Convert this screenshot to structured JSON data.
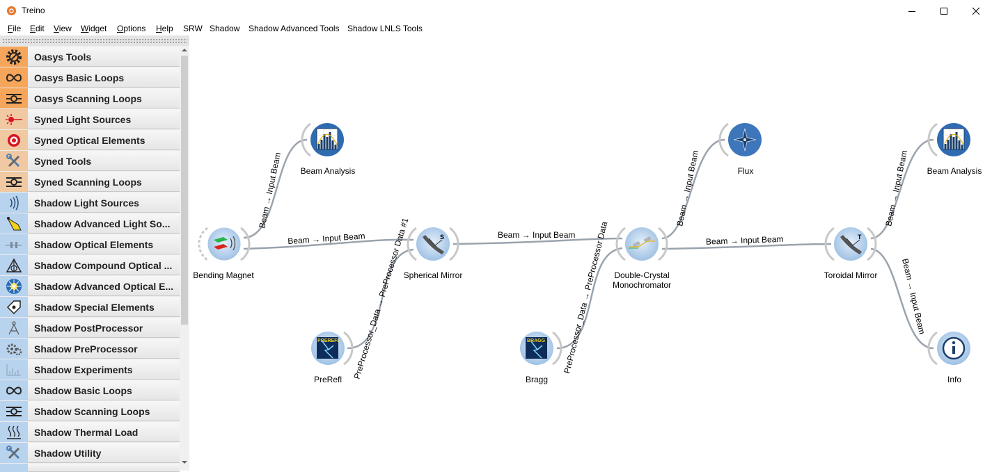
{
  "window": {
    "title": "Treino"
  },
  "menu": [
    {
      "label": "File",
      "u": "F",
      "rest": "ile"
    },
    {
      "label": "Edit",
      "u": "E",
      "rest": "dit"
    },
    {
      "label": "View",
      "u": "V",
      "rest": "iew"
    },
    {
      "label": "Widget",
      "u": "W",
      "rest": "idget"
    },
    {
      "label": "Options",
      "u": "O",
      "rest": "ptions"
    },
    {
      "label": "Help",
      "u": "H",
      "rest": "elp"
    },
    {
      "label": "SRW",
      "u": "",
      "rest": "SRW"
    },
    {
      "label": "Shadow",
      "u": "",
      "rest": "Shadow"
    },
    {
      "label": "Shadow Advanced Tools",
      "u": "",
      "rest": "Shadow Advanced Tools"
    },
    {
      "label": "Shadow LNLS Tools",
      "u": "",
      "rest": "Shadow LNLS Tools"
    }
  ],
  "sidebar": {
    "categories": [
      {
        "label": "Oasys Tools",
        "icon": "gear-icon",
        "color": "#f5a65b"
      },
      {
        "label": "Oasys Basic Loops",
        "icon": "infinity-icon",
        "color": "#f5a65b"
      },
      {
        "label": "Oasys Scanning Loops",
        "icon": "scan-loop-icon",
        "color": "#f5a65b"
      },
      {
        "label": "Syned Light Sources",
        "icon": "laser-icon",
        "color": "#f0c9a2"
      },
      {
        "label": "Syned Optical Elements",
        "icon": "target-icon",
        "color": "#f0c9a2"
      },
      {
        "label": "Syned Tools",
        "icon": "tools-icon",
        "color": "#f0c9a2"
      },
      {
        "label": "Syned Scanning Loops",
        "icon": "scan-loop-icon",
        "color": "#f0c9a2"
      },
      {
        "label": "Shadow Light Sources",
        "icon": "wave-icon",
        "color": "#b8d3ee"
      },
      {
        "label": "Shadow Advanced Light So...",
        "icon": "lamp-icon",
        "color": "#b8d3ee"
      },
      {
        "label": "Shadow Optical Elements",
        "icon": "optics-icon",
        "color": "#b8d3ee"
      },
      {
        "label": "Shadow Compound Optical ...",
        "icon": "prism-icon",
        "color": "#b8d3ee"
      },
      {
        "label": "Shadow Advanced Optical E...",
        "icon": "snowflake-icon",
        "color": "#b8d3ee"
      },
      {
        "label": "Shadow Special Elements",
        "icon": "tag-icon",
        "color": "#b8d3ee"
      },
      {
        "label": "Shadow PostProcessor",
        "icon": "compass-icon",
        "color": "#b8d3ee"
      },
      {
        "label": "Shadow PreProcessor",
        "icon": "gears-icon",
        "color": "#b8d3ee"
      },
      {
        "label": "Shadow Experiments",
        "icon": "spectrum-icon",
        "color": "#b8d3ee"
      },
      {
        "label": "Shadow Basic Loops",
        "icon": "infinity-icon",
        "color": "#b8d3ee"
      },
      {
        "label": "Shadow Scanning Loops",
        "icon": "scan-loop-icon",
        "color": "#b8d3ee"
      },
      {
        "label": "Shadow Thermal Load",
        "icon": "heat-icon",
        "color": "#b8d3ee"
      },
      {
        "label": "Shadow Utility",
        "icon": "tools-icon",
        "color": "#b8d3ee"
      }
    ]
  },
  "workflow": {
    "nodes": [
      {
        "id": "bending-magnet",
        "label": "Bending Magnet",
        "icon": "bending-magnet-icon"
      },
      {
        "id": "beam-analysis-1",
        "label": "Beam Analysis",
        "icon": "histogram-icon"
      },
      {
        "id": "spherical-mirror",
        "label": "Spherical Mirror",
        "icon": "mirror-s-icon",
        "badge": "S"
      },
      {
        "id": "prerefl",
        "label": "PreRefl",
        "icon": "prerefl-icon",
        "badge": "PREREFL"
      },
      {
        "id": "double-crystal",
        "label": "Double-Crystal",
        "label2": "Monochromator",
        "icon": "crystal-icon"
      },
      {
        "id": "flux",
        "label": "Flux",
        "icon": "compass-star-icon"
      },
      {
        "id": "bragg",
        "label": "Bragg",
        "icon": "bragg-icon",
        "badge": "BRAGG"
      },
      {
        "id": "toroidal-mirror",
        "label": "Toroidal Mirror",
        "icon": "mirror-t-icon",
        "badge": "T"
      },
      {
        "id": "beam-analysis-2",
        "label": "Beam Analysis",
        "icon": "histogram-icon"
      },
      {
        "id": "info",
        "label": "Info",
        "icon": "info-icon"
      }
    ],
    "links": [
      {
        "id": "bm-sm",
        "label": "Beam → Input Beam"
      },
      {
        "id": "bm-ba1",
        "label": "Beam → Input Beam"
      },
      {
        "id": "pre-sm",
        "label": "PreProcessor_Data → PreProcessor Data #1"
      },
      {
        "id": "sm-dcm",
        "label": "Beam → Input Beam"
      },
      {
        "id": "bragg-dcm",
        "label": "PreProcessor_Data → PreProcessor Data"
      },
      {
        "id": "dcm-flux",
        "label": "Beam → Input Beam"
      },
      {
        "id": "dcm-tm",
        "label": "Beam → Input Beam"
      },
      {
        "id": "tm-ba2",
        "label": "Beam → Input Beam"
      },
      {
        "id": "tm-info",
        "label": "Beam → Input Beam"
      }
    ]
  }
}
